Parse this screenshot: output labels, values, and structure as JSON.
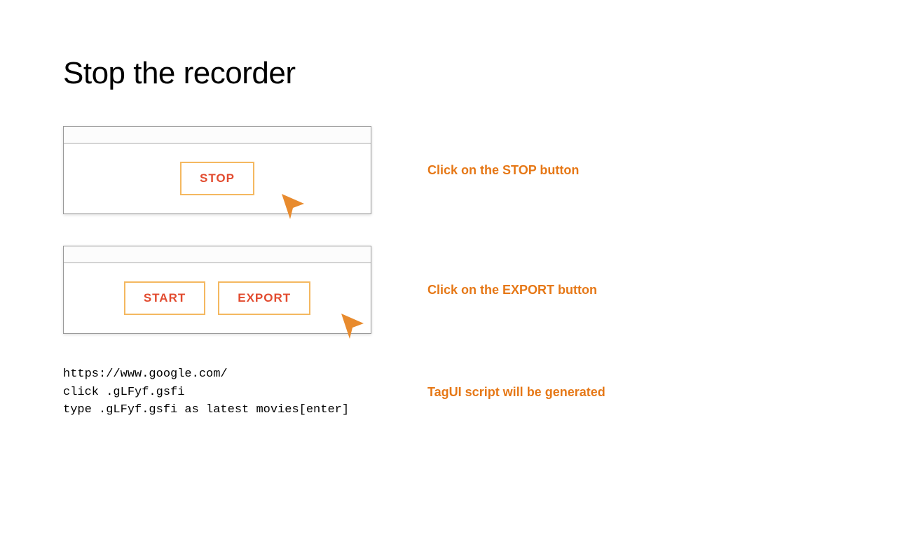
{
  "title": "Stop the recorder",
  "panel1": {
    "buttons": {
      "stop": "STOP"
    },
    "caption": "Click on the STOP button"
  },
  "panel2": {
    "buttons": {
      "start": "START",
      "export": "EXPORT"
    },
    "caption": "Click on the EXPORT button"
  },
  "script": {
    "line1": "https://www.google.com/",
    "line2": "click .gLFyf.gsfi",
    "line3": "type .gLFyf.gsfi as latest movies[enter]",
    "caption": "TagUI script will be generated"
  },
  "colors": {
    "accent": "#e67817",
    "btnBorder": "#f4b860",
    "btnText": "#e24b2f"
  }
}
